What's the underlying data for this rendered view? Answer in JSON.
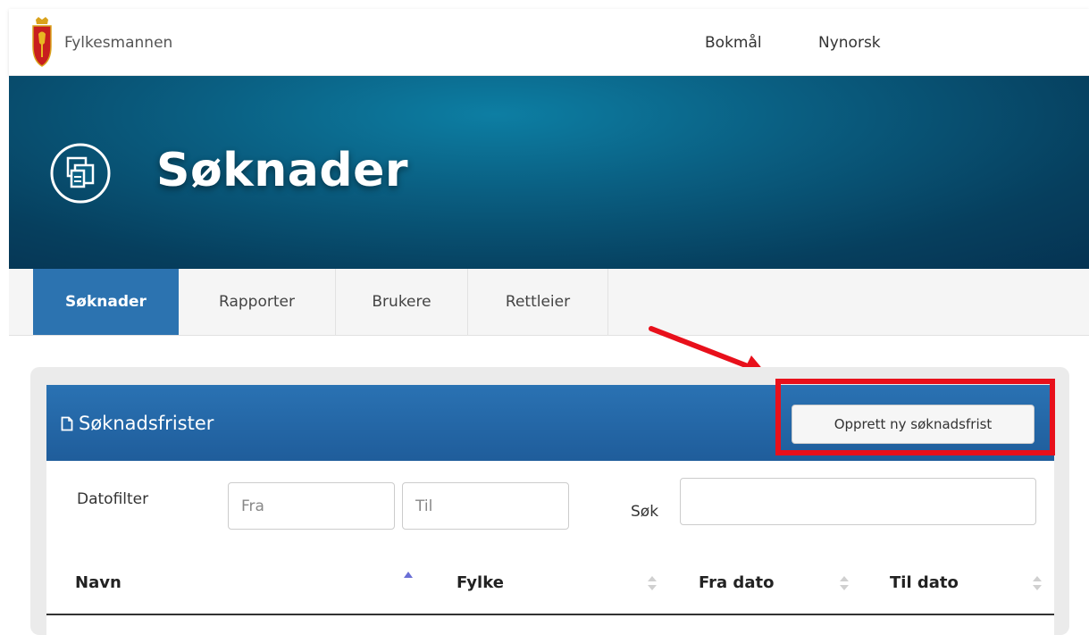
{
  "topbar": {
    "brand": "Fylkesmannen",
    "languages": [
      "Bokmål",
      "Nynorsk"
    ]
  },
  "hero": {
    "title": "Søknader",
    "icon": "application-stack-icon"
  },
  "tabs": [
    {
      "label": "Søknader",
      "active": true
    },
    {
      "label": "Rapporter",
      "active": false
    },
    {
      "label": "Brukere",
      "active": false
    },
    {
      "label": "Rettleier",
      "active": false
    }
  ],
  "panel": {
    "title": "Søknadsfrister",
    "title_icon": "file-icon",
    "new_button_label": "Opprett ny søknadsfrist"
  },
  "filters": {
    "date_label": "Datofilter",
    "from_placeholder": "Fra",
    "to_placeholder": "Til",
    "search_label": "Søk",
    "search_value": ""
  },
  "table": {
    "columns": [
      {
        "label": "Navn",
        "sort": "ascending"
      },
      {
        "label": "Fylke",
        "sort": "none"
      },
      {
        "label": "Fra dato",
        "sort": "none"
      },
      {
        "label": "Til dato",
        "sort": "none"
      }
    ],
    "rows": []
  },
  "colors": {
    "accent": "#2c73b0",
    "hero_dark": "#053352",
    "highlight": "#e8101b"
  }
}
